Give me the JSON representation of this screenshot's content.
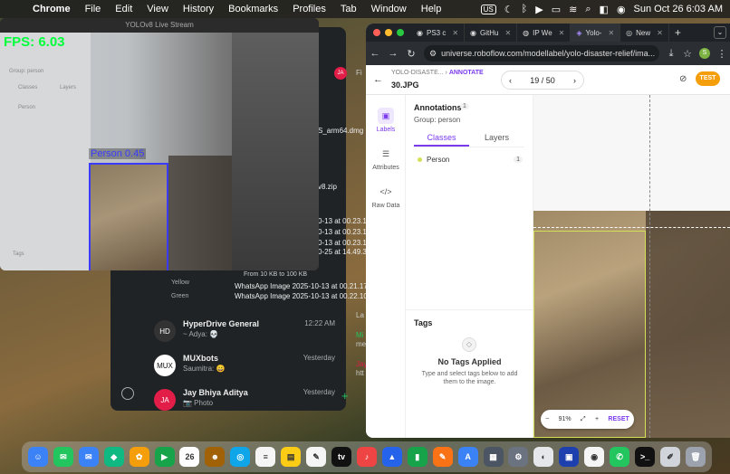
{
  "menubar": {
    "app": "Chrome",
    "items": [
      "File",
      "Edit",
      "View",
      "History",
      "Bookmarks",
      "Profiles",
      "Tab",
      "Window",
      "Help"
    ],
    "input_source": "US",
    "datetime": "Sun Oct 26  6:03 AM"
  },
  "yolo": {
    "title": "YOLOv8 Live Stream",
    "fps": "FPS: 6.03",
    "detection_label": "Person 0.45",
    "inner_group": "Group: person",
    "inner_tab_classes": "Classes",
    "inner_tab_layers": "Layers",
    "inner_class": "Person",
    "inner_tags": "Tags"
  },
  "downloads": {
    "items": [
      "S_arm64.dmg",
      "v8.zip",
      "0-13 at 00.23.1",
      "0-13 at 00.23.1",
      "0-13 at 00.23.1",
      "0-25 at 14.49.3",
      "From 10 KB to 100 KB",
      "WhatsApp Image 2025-10-13 at 00.21.17",
      "WhatsApp Image 2025-10-13 at 00.22.10"
    ],
    "filters": [
      "Yellow",
      "Green"
    ]
  },
  "chat": {
    "rows": [
      {
        "avatar": "HD",
        "name": "HyperDrive General",
        "sub": "~ Adya: 💀",
        "time": "12:22 AM"
      },
      {
        "avatar": "MUX",
        "name": "MUXbots",
        "sub": "Saumitra: 😀",
        "time": "Yesterday"
      },
      {
        "avatar": "JA",
        "name": "Jay Bhiya Aditya",
        "sub": "📷 Photo",
        "time": "Yesterday"
      }
    ],
    "side_chats": [
      "JA",
      "Fi",
      "La",
      "Mi",
      "me",
      "Jay",
      "htt"
    ]
  },
  "browser": {
    "tabs": [
      {
        "label": "PS3 c",
        "icon": "github-icon"
      },
      {
        "label": "GitHu",
        "icon": "github-icon"
      },
      {
        "label": "IP We",
        "icon": "globe-icon"
      },
      {
        "label": "Yolo-",
        "icon": "roboflow-icon"
      },
      {
        "label": "New",
        "icon": "chrome-icon"
      }
    ],
    "url": "universe.roboflow.com/modellabel/yolo-disaster-relief/ima...",
    "profile_initial": "S"
  },
  "roboflow": {
    "project": "YOLO-DISASTE...",
    "mode": "ANNOTATE",
    "filename": "30.JPG",
    "page": "19 / 50",
    "test_label": "TEST",
    "tools": [
      {
        "label": "Labels",
        "icon": "labels-icon"
      },
      {
        "label": "Attributes",
        "icon": "list-icon"
      },
      {
        "label": "Raw Data",
        "icon": "code-icon"
      }
    ],
    "annotations_title": "Annotations",
    "annotations_count": "1",
    "group": "Group: person",
    "tab_classes": "Classes",
    "tab_layers": "Layers",
    "class_name": "Person",
    "class_count": "1",
    "tags_title": "Tags",
    "no_tags_title": "No Tags Applied",
    "no_tags_desc": "Type and select tags below to add them to the image.",
    "zoom": "91%",
    "reset": "RESET"
  },
  "dock": {
    "apps": [
      {
        "name": "Finder",
        "color": "#3b82f6",
        "glyph": "☺"
      },
      {
        "name": "Messages",
        "color": "#22c55e",
        "glyph": "✉"
      },
      {
        "name": "Mail",
        "color": "#3b82f6",
        "glyph": "✉"
      },
      {
        "name": "Maps",
        "color": "#10b981",
        "glyph": "◆"
      },
      {
        "name": "Photos",
        "color": "#f59e0b",
        "glyph": "✿"
      },
      {
        "name": "FaceTime",
        "color": "#16a34a",
        "glyph": "▶"
      },
      {
        "name": "Calendar",
        "color": "#ffffff",
        "glyph": "26"
      },
      {
        "name": "Contacts",
        "color": "#a16207",
        "glyph": "☻"
      },
      {
        "name": "Safari",
        "color": "#0ea5e9",
        "glyph": "◎"
      },
      {
        "name": "Reminders",
        "color": "#f5f5f5",
        "glyph": "≡"
      },
      {
        "name": "Notes",
        "color": "#facc15",
        "glyph": "▤"
      },
      {
        "name": "Freeform",
        "color": "#f5f5f5",
        "glyph": "✎"
      },
      {
        "name": "TV",
        "color": "#111111",
        "glyph": "tv"
      },
      {
        "name": "Music",
        "color": "#ef4444",
        "glyph": "♪"
      },
      {
        "name": "Keynote",
        "color": "#2563eb",
        "glyph": "▲"
      },
      {
        "name": "Numbers",
        "color": "#16a34a",
        "glyph": "▮"
      },
      {
        "name": "Pages",
        "color": "#f97316",
        "glyph": "✎"
      },
      {
        "name": "App Store",
        "color": "#3b82f6",
        "glyph": "A"
      },
      {
        "name": "Launchpad",
        "color": "#4b5563",
        "glyph": "▦"
      },
      {
        "name": "Settings",
        "color": "#6b7280",
        "glyph": "⚙"
      },
      {
        "name": "Preview",
        "color": "#e5e7eb",
        "glyph": "◐"
      },
      {
        "name": "Screen",
        "color": "#1e40af",
        "glyph": "▣"
      },
      {
        "name": "Chrome",
        "color": "#f5f5f5",
        "glyph": "◉"
      },
      {
        "name": "WhatsApp",
        "color": "#22c55e",
        "glyph": "✆"
      },
      {
        "name": "Terminal",
        "color": "#111111",
        "glyph": ">_"
      },
      {
        "name": "Pencil",
        "color": "#d1d5db",
        "glyph": "✐"
      },
      {
        "name": "Trash",
        "color": "#9ca3af",
        "glyph": "🗑"
      }
    ]
  }
}
